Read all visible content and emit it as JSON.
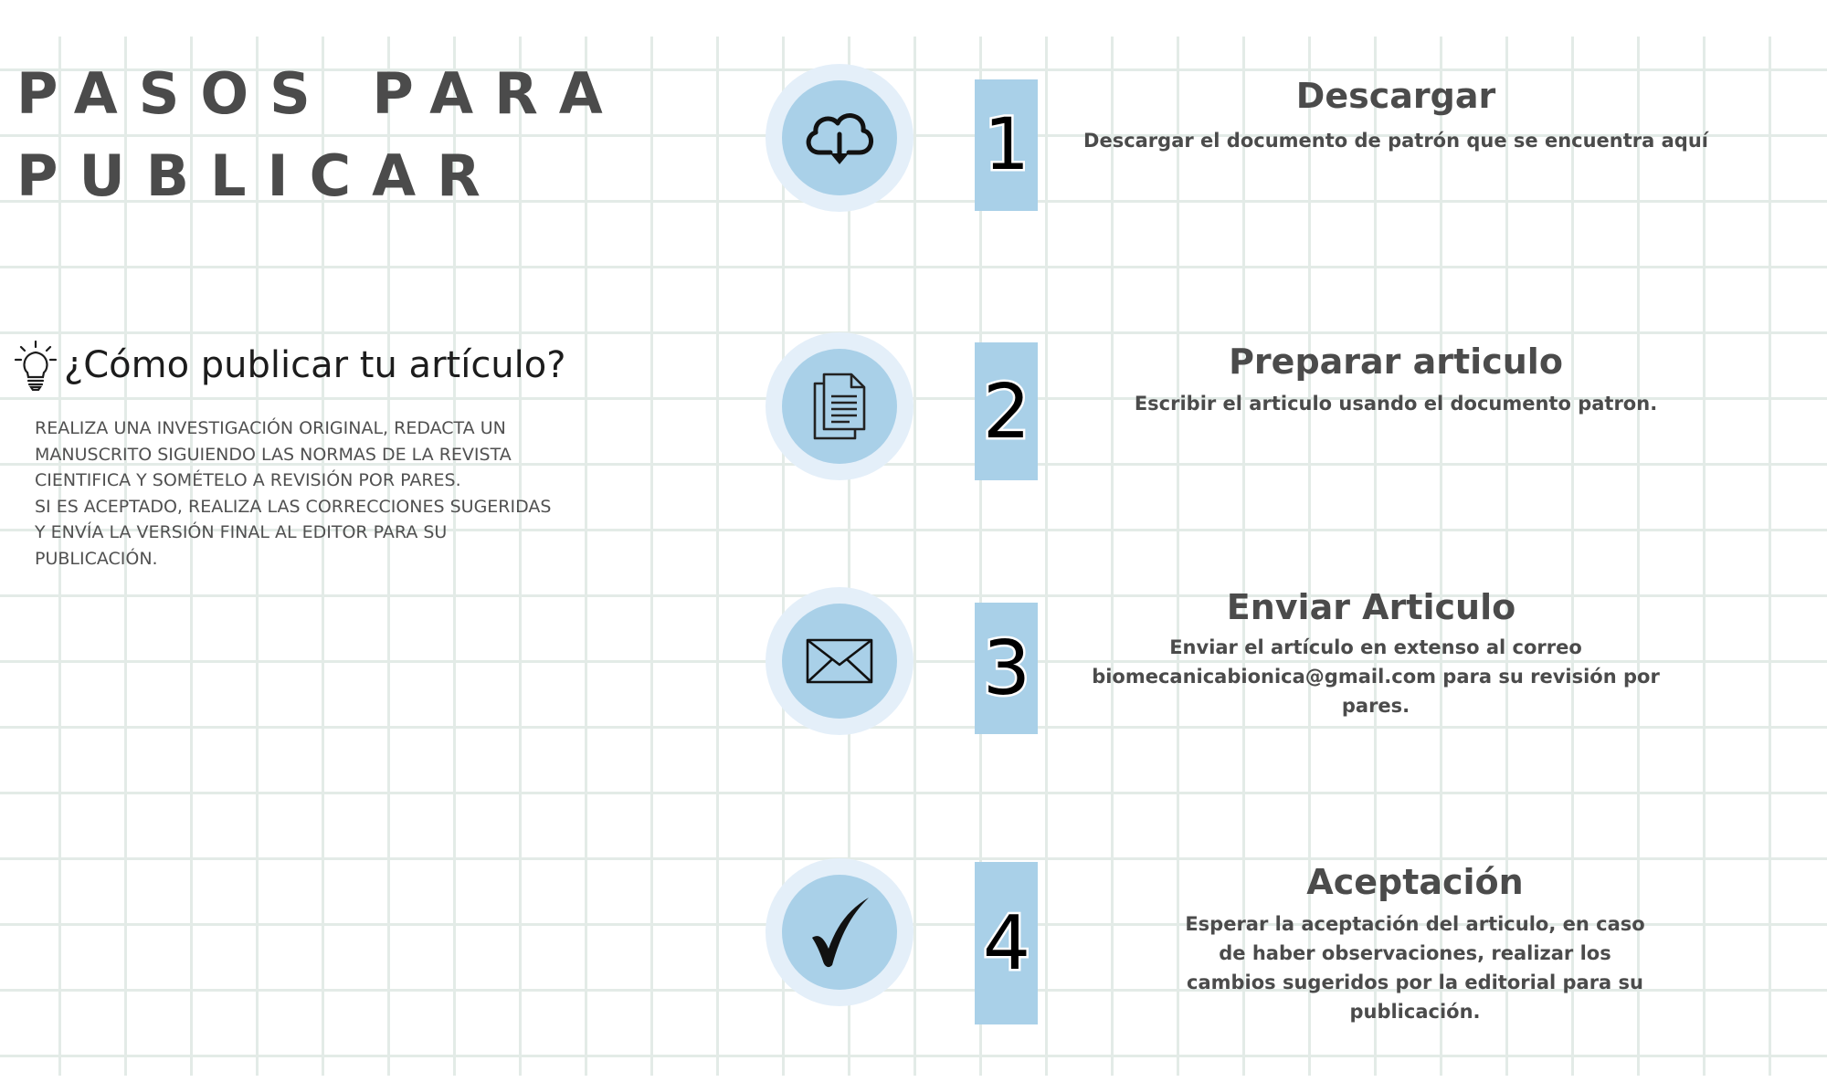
{
  "title_lines": [
    "PASOS PARA",
    "PUBLICAR"
  ],
  "subtitle": "¿Cómo publicar tu artículo?",
  "intro_lines": [
    "REALIZA UNA INVESTIGACIÓN ORIGINAL, REDACTA UN",
    "MANUSCRITO SIGUIENDO LAS NORMAS DE LA REVISTA",
    "CIENTIFICA Y SOMÉTELO A REVISIÓN POR PARES.",
    "SI ES ACEPTADO, REALIZA LAS CORRECCIONES SUGERIDAS",
    "Y ENVÍA LA VERSIÓN FINAL AL EDITOR PARA SU",
    "PUBLICACIÓN."
  ],
  "steps": [
    {
      "number": "1",
      "icon": "cloud-download-icon",
      "title": "Descargar",
      "description_lines": [
        "Descargar el documento de patrón que se encuentra aquí"
      ]
    },
    {
      "number": "2",
      "icon": "document-icon",
      "title": "Preparar articulo",
      "description_lines": [
        "Escribir el articulo usando el documento patron."
      ]
    },
    {
      "number": "3",
      "icon": "envelope-icon",
      "title": "Enviar Articulo",
      "description_lines": [
        "Enviar el artículo en extenso al correo",
        "biomecanicabionica@gmail.com para su revisión por",
        "pares."
      ]
    },
    {
      "number": "4",
      "icon": "checkmark-icon",
      "title": "Aceptación",
      "description_lines": [
        "Esperar la aceptación del articulo, en caso",
        "de haber observaciones, realizar los",
        "cambios sugeridos por la editorial para su",
        "publicación."
      ]
    }
  ],
  "colors": {
    "accent": "#a9d0e8",
    "halo": "#e4eff9",
    "text": "#4b4b4b",
    "grid": "#e3ebe7"
  }
}
